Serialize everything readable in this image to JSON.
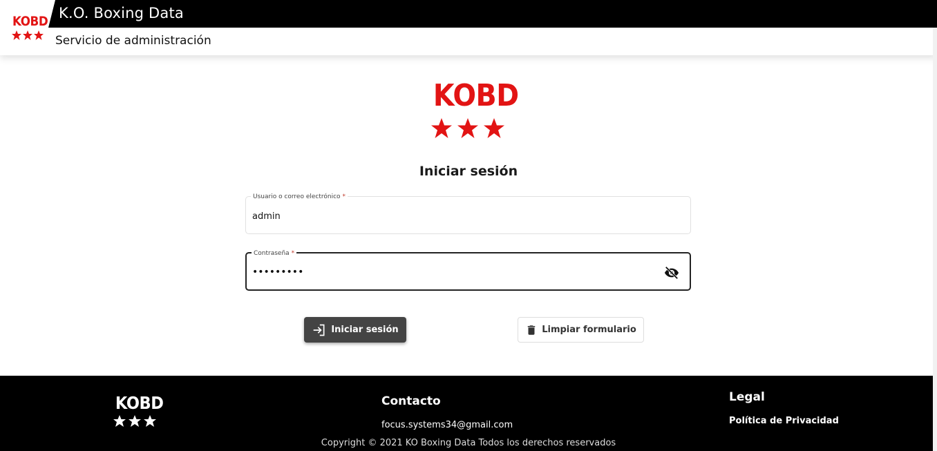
{
  "header": {
    "logo_text": "KOBD",
    "app_title": "K.O. Boxing Data",
    "subtitle": "Servicio de administración"
  },
  "logo": {
    "text": "KOBD",
    "brand_color": "#e21414"
  },
  "login_form": {
    "title": "Iniciar sesión",
    "username_label": "Usuario o correo electrónico",
    "username_value": "admin",
    "password_label": "Contraseña",
    "password_value": "•••••••••",
    "required_marker": "*",
    "toggle_icon": "eye-off-icon",
    "login_button_label": "Iniciar sesión",
    "login_button_icon": "login-icon",
    "clear_button_label": "Limpiar formulario",
    "clear_button_icon": "trash-icon"
  },
  "footer": {
    "logo_text": "KOBD",
    "contact_title": "Contacto",
    "contact_email": "focus.systems34@gmail.com",
    "legal_title": "Legal",
    "privacy_link": "Política de Privacidad",
    "copyright": "Copyright © 2021 KO Boxing Data Todos los derechos reservados"
  }
}
